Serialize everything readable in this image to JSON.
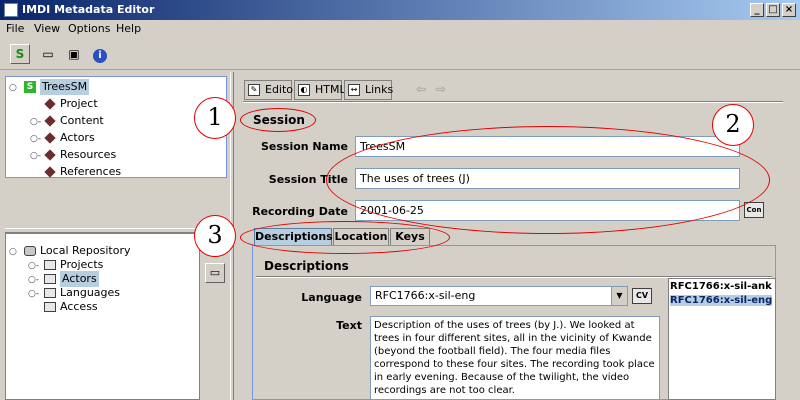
{
  "window": {
    "title": "IMDI Metadata Editor",
    "controls": [
      "_",
      "□",
      "×"
    ]
  },
  "menu": [
    "File",
    "View",
    "Options",
    "Help"
  ],
  "toolbar": {
    "icons": [
      "session-icon",
      "open-folder-icon",
      "save-icon",
      "info-icon"
    ]
  },
  "tree_top": {
    "root": "TreesSM",
    "children": [
      "Project",
      "Content",
      "Actors",
      "Resources",
      "References"
    ]
  },
  "tree_bottom": {
    "root": "Local Repository",
    "children": [
      "Projects",
      "Actors",
      "Languages",
      "Access"
    ],
    "selected": "Actors"
  },
  "view_tabs": [
    "Editor",
    "HTML",
    "Links"
  ],
  "session": {
    "heading": "Session",
    "name_label": "Session Name",
    "name_value": "TreesSM",
    "title_label": "Session Title",
    "title_value": "The uses of trees (J)",
    "date_label": "Recording Date",
    "date_value": "2001-06-25",
    "date_button": "Con"
  },
  "sub_tabs": [
    "Descriptions",
    "Location",
    "Keys"
  ],
  "descriptions": {
    "heading": "Descriptions",
    "language_label": "Language",
    "language_value": "RFC1766:x-sil-eng",
    "cv_button": "CV",
    "text_label": "Text",
    "text_value": "Description of the uses of trees (by J.).  We looked at trees in four different sites, all in the vicinity of Kwande (beyond the football field). The four media files correspond to these four sites.  The recording took place in early evening. Because of the twilight, the video recordings are not too clear.",
    "language_list": [
      "RFC1766:x-sil-ank",
      "RFC1766:x-sil-eng"
    ]
  },
  "callouts": [
    "1",
    "2",
    "3"
  ]
}
